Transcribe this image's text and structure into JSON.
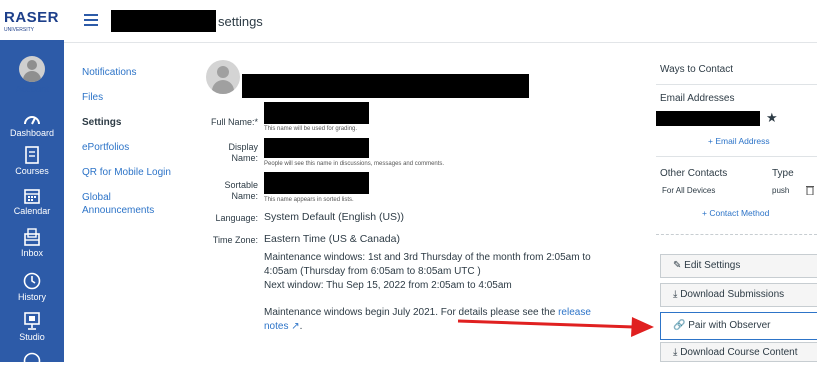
{
  "brand": {
    "logo_text": "RASER",
    "logo_sub": "UNIVERSITY"
  },
  "global_nav": {
    "account": "Account",
    "dashboard": "Dashboard",
    "courses": "Courses",
    "calendar": "Calendar",
    "inbox": "Inbox",
    "history": "History",
    "studio": "Studio"
  },
  "header": {
    "title": "settings"
  },
  "subnav": [
    "Notifications",
    "Files",
    "Settings",
    "ePortfolios",
    "QR for Mobile Login",
    "Global",
    "Announcements"
  ],
  "profile": {
    "full_name_label": "Full Name:*",
    "full_name_hint": "This name will be used for grading.",
    "display_label": "Display",
    "display_label2": "Name:",
    "display_hint": "People will see this name in discussions, messages and comments.",
    "sortable_label": "Sortable",
    "sortable_label2": "Name:",
    "sortable_hint": "This name appears in sorted lists.",
    "language_label": "Language:",
    "language_value": "System Default (English (US))",
    "timezone_label": "Time Zone:",
    "timezone_value": "Eastern Time (US & Canada)",
    "maint_line1": "Maintenance windows: 1st and 3rd Thursday of the month from 2:05am to",
    "maint_line2": "4:05am (Thursday from 6:05am to 8:05am UTC )",
    "next_window": "Next window: Thu Sep 15, 2022 from 2:05am to 4:05am",
    "begin_text": "Maintenance windows begin July 2021. For details please see the",
    "release_link": "release",
    "notes_link": "notes",
    "period": "."
  },
  "right_panel": {
    "ways_to_contact": "Ways to Contact",
    "email_addresses": "Email Addresses",
    "add_email": "+ Email Address",
    "other_contacts": "Other Contacts",
    "type_header": "Type",
    "for_all_devices": "For All Devices",
    "push": "push",
    "add_contact": "+ Contact Method",
    "star": "★"
  },
  "buttons": {
    "edit_settings": "Edit Settings",
    "download_submissions": "Download Submissions",
    "pair_with_observer": "Pair with Observer",
    "download_course_content": "Download Course Content"
  },
  "colors": {
    "nav_bg": "#2d5ba8",
    "link": "#2d74c8",
    "arrow": "#e02020"
  }
}
